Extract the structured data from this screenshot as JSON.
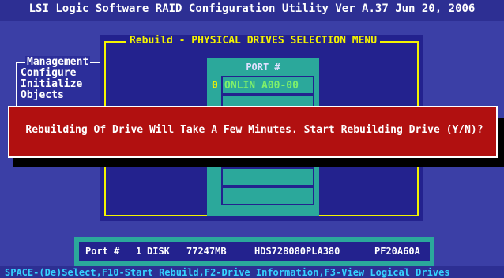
{
  "header": {
    "title": "LSI Logic Software RAID Configuration Utility Ver A.37 Jun 20, 2006"
  },
  "management_menu": {
    "title": "Management",
    "items": [
      "Configure",
      "Initialize",
      "Objects"
    ]
  },
  "rebuild_menu": {
    "title": "Rebuild - PHYSICAL DRIVES SELECTION MENU",
    "port_header": "PORT #",
    "drives": [
      {
        "port": "0",
        "status": "ONLIN A00-00"
      }
    ]
  },
  "dialog": {
    "message": "Rebuilding Of Drive Will Take A Few Minutes. Start Rebuilding Drive (Y/N)?"
  },
  "drive_info": {
    "port_label": "Port #",
    "port_value": "1",
    "type": "DISK",
    "size": "77247MB",
    "model": "HDS728080PLA380",
    "firmware": "PF20A60A"
  },
  "footer": {
    "hint": "SPACE-(De)Select,F10-Start Rebuild,F2-Drive Information,F3-View Logical Drives"
  },
  "colors": {
    "background": "#3b3fa6",
    "menu_border": "#f4f400",
    "panel": "#2ba89b",
    "dialog": "#b11010",
    "online_drive": "#7ff06a",
    "footer_text": "#35d3ff"
  }
}
